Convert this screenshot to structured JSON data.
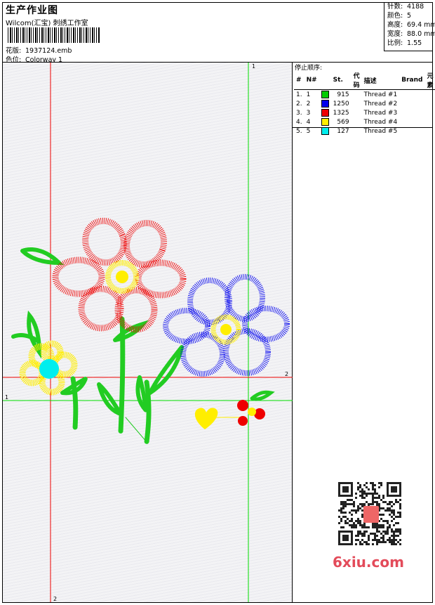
{
  "header": {
    "title": "生产作业图",
    "company": "Wilcom(汇宝) 刺绣工作室",
    "design_label": "花版:",
    "design_value": "1937124.emb",
    "colorway_label": "色位:",
    "colorway_value": "Colorway 1"
  },
  "stats": {
    "stitches_label": "针数:",
    "stitches_value": "4188",
    "colors_label": "颜色:",
    "colors_value": "5",
    "height_label": "高度:",
    "height_value": "69.4 mm",
    "width_label": "宽度:",
    "width_value": "88.0 mm",
    "scale_label": "比例:",
    "scale_value": "1.55"
  },
  "stop_sequence": {
    "title": "停止顺序:",
    "headers": [
      "#",
      "N#",
      "St.",
      "代码",
      "描述",
      "Brand",
      "元素"
    ],
    "rows": [
      {
        "num": "1.",
        "n": "1",
        "color": "#00cc00",
        "st": "915",
        "desc": "Thread #1"
      },
      {
        "num": "2.",
        "n": "2",
        "color": "#0000ee",
        "st": "1250",
        "desc": "Thread #2"
      },
      {
        "num": "3.",
        "n": "3",
        "color": "#ee0000",
        "st": "1325",
        "desc": "Thread #3"
      },
      {
        "num": "4.",
        "n": "4",
        "color": "#ffee00",
        "st": "569",
        "desc": "Thread #4"
      },
      {
        "num": "5.",
        "n": "5",
        "color": "#00eeee",
        "st": "127",
        "desc": "Thread #5"
      }
    ]
  },
  "guides": {
    "v_green": "1",
    "h_red": "2",
    "h_green": "1",
    "v_red": "2"
  },
  "colors": {
    "green": "#22cc22",
    "blue": "#0000ee",
    "red": "#ee0000",
    "yellow": "#ffee00",
    "cyan": "#00eeee"
  },
  "watermark": {
    "site": "6xiu.com",
    "stamp": "刺绣图"
  }
}
